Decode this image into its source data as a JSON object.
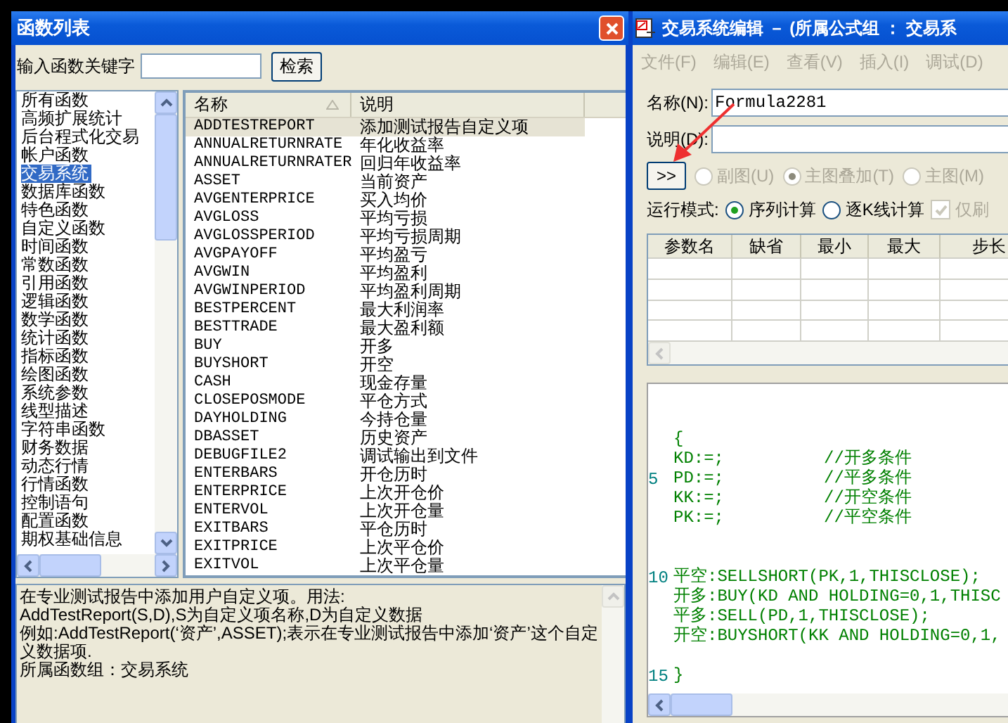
{
  "function_dialog": {
    "title": "函数列表",
    "search": {
      "label": "输入函数关键字",
      "button": "检索"
    },
    "categories": [
      {
        "label": "所有函数",
        "selected": false
      },
      {
        "label": "高频扩展统计",
        "selected": false
      },
      {
        "label": "后台程式化交易",
        "selected": false
      },
      {
        "label": "帐户函数",
        "selected": false
      },
      {
        "label": "交易系统",
        "selected": true
      },
      {
        "label": "数据库函数",
        "selected": false
      },
      {
        "label": "特色函数",
        "selected": false
      },
      {
        "label": "自定义函数",
        "selected": false
      },
      {
        "label": "时间函数",
        "selected": false
      },
      {
        "label": "常数函数",
        "selected": false
      },
      {
        "label": "引用函数",
        "selected": false
      },
      {
        "label": "逻辑函数",
        "selected": false
      },
      {
        "label": "数学函数",
        "selected": false
      },
      {
        "label": "统计函数",
        "selected": false
      },
      {
        "label": "指标函数",
        "selected": false
      },
      {
        "label": "绘图函数",
        "selected": false
      },
      {
        "label": "系统参数",
        "selected": false
      },
      {
        "label": "线型描述",
        "selected": false
      },
      {
        "label": "字符串函数",
        "selected": false
      },
      {
        "label": "财务数据",
        "selected": false
      },
      {
        "label": "动态行情",
        "selected": false
      },
      {
        "label": "行情函数",
        "selected": false
      },
      {
        "label": "控制语句",
        "selected": false
      },
      {
        "label": "配置函数",
        "selected": false
      },
      {
        "label": "期权基础信息",
        "selected": false
      }
    ],
    "table": {
      "columns": [
        "名称",
        "说明"
      ],
      "rows": [
        {
          "name": "ADDTESTREPORT",
          "description": "添加测试报告自定义项",
          "selected": true
        },
        {
          "name": "ANNUALRETURNRATE",
          "description": "年化收益率",
          "selected": false
        },
        {
          "name": "ANNUALRETURNRATER",
          "description": "回归年收益率",
          "selected": false
        },
        {
          "name": "ASSET",
          "description": "当前资产",
          "selected": false
        },
        {
          "name": "AVGENTERPRICE",
          "description": "买入均价",
          "selected": false
        },
        {
          "name": "AVGLOSS",
          "description": "平均亏损",
          "selected": false
        },
        {
          "name": "AVGLOSSPERIOD",
          "description": "平均亏损周期",
          "selected": false
        },
        {
          "name": "AVGPAYOFF",
          "description": "平均盈亏",
          "selected": false
        },
        {
          "name": "AVGWIN",
          "description": "平均盈利",
          "selected": false
        },
        {
          "name": "AVGWINPERIOD",
          "description": "平均盈利周期",
          "selected": false
        },
        {
          "name": "BESTPERCENT",
          "description": "最大利润率",
          "selected": false
        },
        {
          "name": "BESTTRADE",
          "description": "最大盈利额",
          "selected": false
        },
        {
          "name": "BUY",
          "description": "开多",
          "selected": false
        },
        {
          "name": "BUYSHORT",
          "description": "开空",
          "selected": false
        },
        {
          "name": "CASH",
          "description": "现金存量",
          "selected": false
        },
        {
          "name": "CLOSEPOSMODE",
          "description": "平仓方式",
          "selected": false
        },
        {
          "name": "DAYHOLDING",
          "description": "今持仓量",
          "selected": false
        },
        {
          "name": "DBASSET",
          "description": "历史资产",
          "selected": false
        },
        {
          "name": "DEBUGFILE2",
          "description": "调试输出到文件",
          "selected": false
        },
        {
          "name": "ENTERBARS",
          "description": "开仓历时",
          "selected": false
        },
        {
          "name": "ENTERPRICE",
          "description": "上次开仓价",
          "selected": false
        },
        {
          "name": "ENTERVOL",
          "description": "上次开仓量",
          "selected": false
        },
        {
          "name": "EXITBARS",
          "description": "平仓历时",
          "selected": false
        },
        {
          "name": "EXITPRICE",
          "description": "上次平仓价",
          "selected": false
        },
        {
          "name": "EXITVOL",
          "description": "上次平仓量",
          "selected": false
        }
      ]
    },
    "details": [
      "在专业测试报告中添加用户自定义项。用法:",
      "AddTestReport(S,D),S为自定义项名称,D为自定义数据",
      "例如:AddTestReport(‘资产’,ASSET);表示在专业测试报告中添加‘资产’这个自定义数据项.",
      "所属函数组：交易系统"
    ]
  },
  "editor_window": {
    "title": "交易系统编辑 － (所属公式组 ： 交易系",
    "menu": [
      {
        "label": "文件(F)",
        "disabled": true
      },
      {
        "label": "编辑(E)",
        "disabled": true
      },
      {
        "label": "查看(V)",
        "disabled": true
      },
      {
        "label": "插入(I)",
        "disabled": true
      },
      {
        "label": "调试(D)",
        "disabled": true
      }
    ],
    "name_field": {
      "label": "名称(N):",
      "value": "Formula2281"
    },
    "description_field": {
      "label": "说明(D):"
    },
    "expand_button": ">>",
    "chart_options": [
      {
        "label": "副图(U)",
        "selected": false,
        "disabled": true
      },
      {
        "label": "主图叠加(T)",
        "selected": true,
        "disabled": true
      },
      {
        "label": "主图(M)",
        "selected": false,
        "disabled": true
      }
    ],
    "run_mode": {
      "label": "运行模式:",
      "options": [
        {
          "label": "序列计算",
          "selected": true,
          "disabled": false
        },
        {
          "label": "逐K线计算",
          "selected": false,
          "disabled": false
        }
      ],
      "checkbox": {
        "label": "仅刷",
        "checked": true,
        "disabled": true
      }
    },
    "parameters": {
      "columns": [
        "参数名",
        "缺省",
        "最小",
        "最大",
        "步长"
      ]
    },
    "code_lines": [
      {
        "kind": "blank"
      },
      {
        "kind": "blank"
      },
      {
        "kind": "code",
        "code": "{"
      },
      {
        "kind": "code",
        "code": "KD:=;",
        "comment": "//开多条件"
      },
      {
        "kind": "code",
        "number": "5",
        "code": "PD:=;",
        "comment": "//平多条件"
      },
      {
        "kind": "code",
        "code": "KK:=;",
        "comment": "//开空条件"
      },
      {
        "kind": "code",
        "code": "PK:=;",
        "comment": "//平空条件"
      },
      {
        "kind": "blank"
      },
      {
        "kind": "blank"
      },
      {
        "kind": "code",
        "number": "10",
        "code": "平空:SELLSHORT(PK,1,THISCLOSE);"
      },
      {
        "kind": "code",
        "code": "开多:BUY(KD AND HOLDING=0,1,THISC"
      },
      {
        "kind": "code",
        "code": "平多:SELL(PD,1,THISCLOSE);"
      },
      {
        "kind": "code",
        "code": "开空:BUYSHORT(KK AND HOLDING=0,1,"
      },
      {
        "kind": "blank"
      },
      {
        "kind": "code",
        "number": "15",
        "code": "}"
      }
    ]
  }
}
